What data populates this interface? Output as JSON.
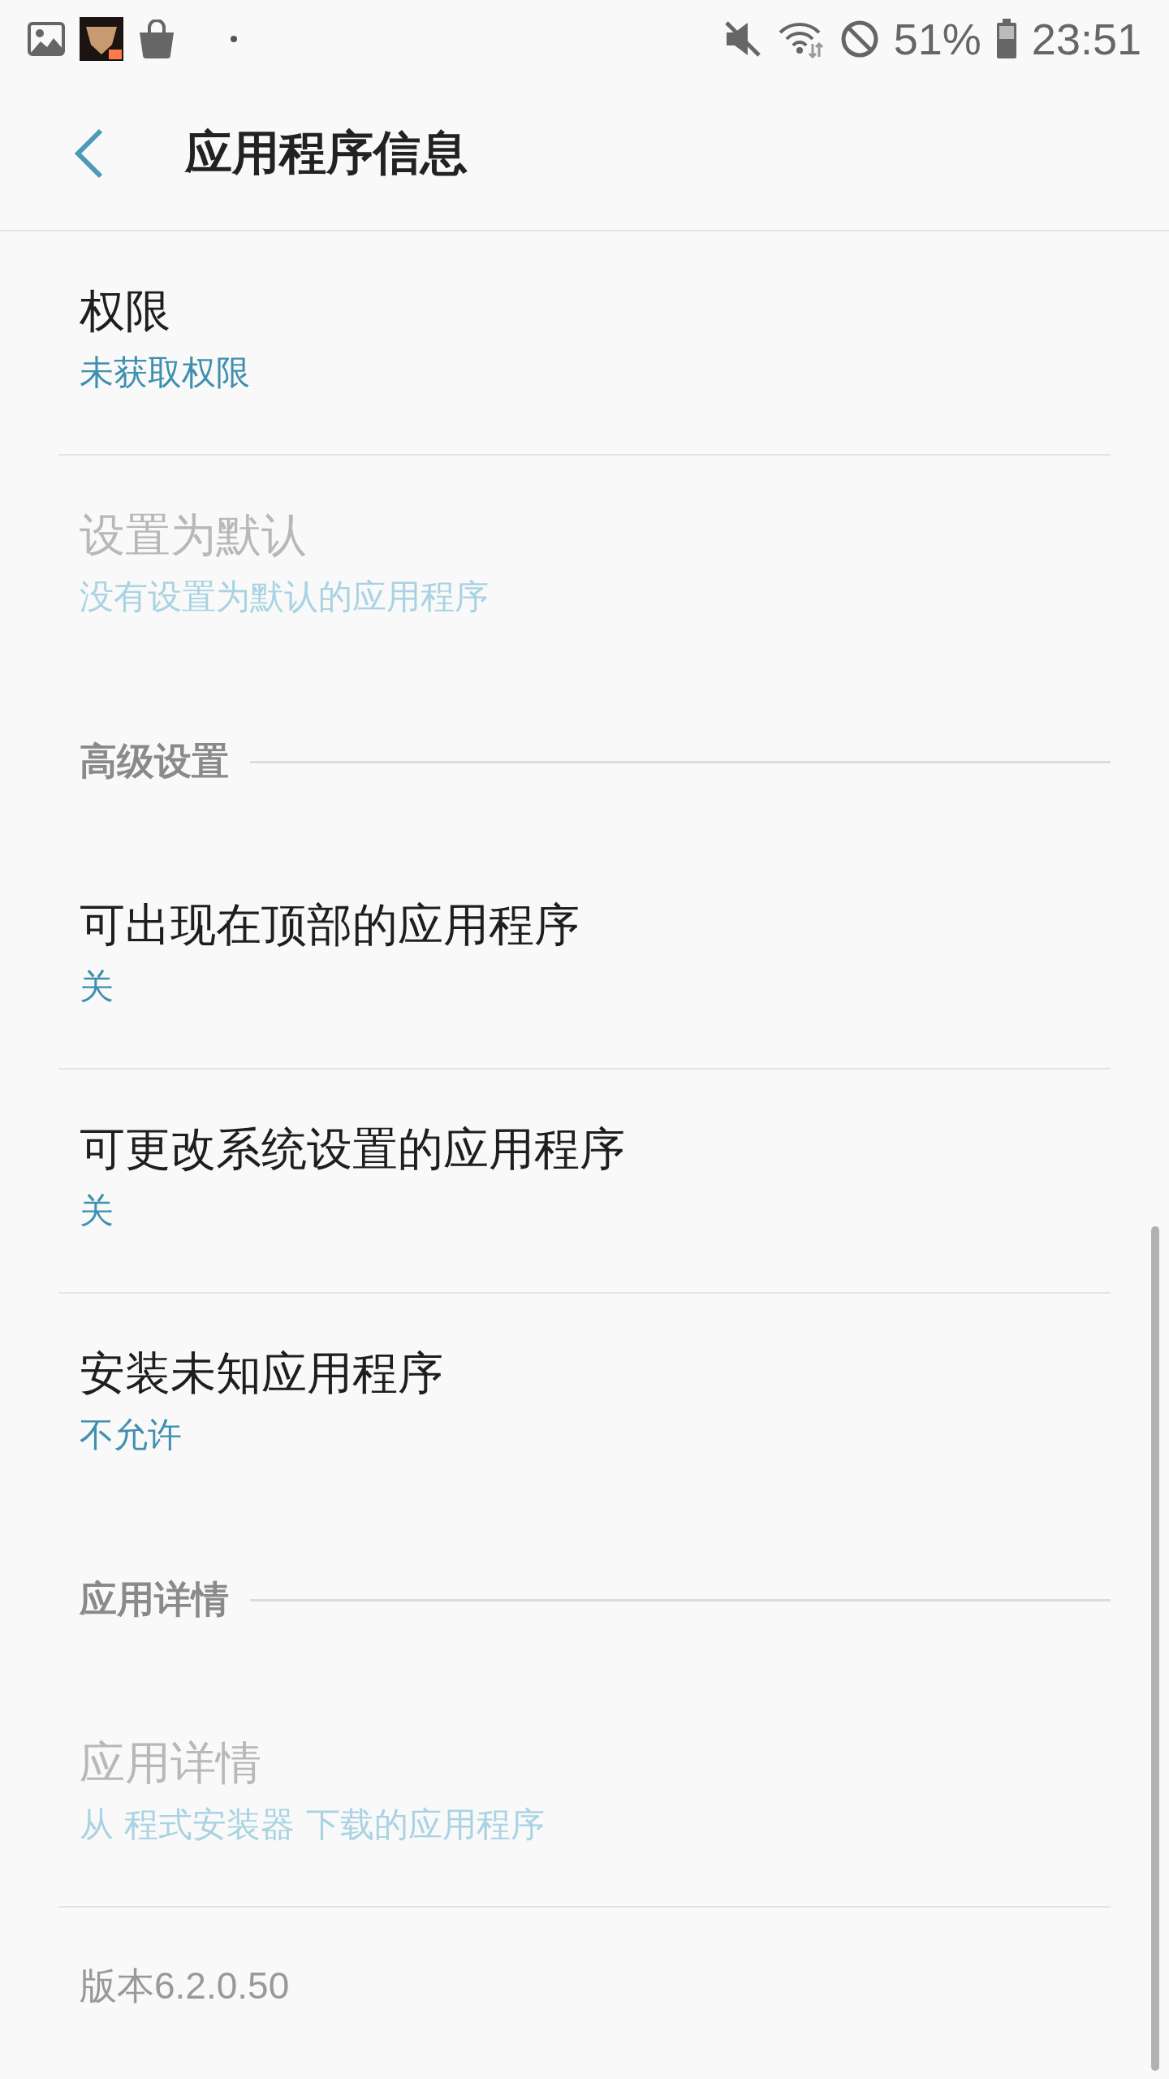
{
  "status_bar": {
    "battery": "51%",
    "time": "23:51"
  },
  "header": {
    "title": "应用程序信息"
  },
  "rows": [
    {
      "kind": "item",
      "title": "权限",
      "subtitle": "未获取权限",
      "disabled": false
    },
    {
      "kind": "item",
      "title": "设置为默认",
      "subtitle": "没有设置为默认的应用程序",
      "disabled": true
    },
    {
      "kind": "section",
      "title": "高级设置"
    },
    {
      "kind": "item",
      "title": "可出现在顶部的应用程序",
      "subtitle": "关",
      "disabled": false
    },
    {
      "kind": "item",
      "title": "可更改系统设置的应用程序",
      "subtitle": "关",
      "disabled": false
    },
    {
      "kind": "item",
      "title": "安装未知应用程序",
      "subtitle": "不允许",
      "disabled": false
    },
    {
      "kind": "section",
      "title": "应用详情"
    },
    {
      "kind": "item",
      "title": "应用详情",
      "subtitle": "从 程式安装器 下载的应用程序",
      "disabled": true
    },
    {
      "kind": "version",
      "title": "版本6.2.0.50"
    }
  ]
}
